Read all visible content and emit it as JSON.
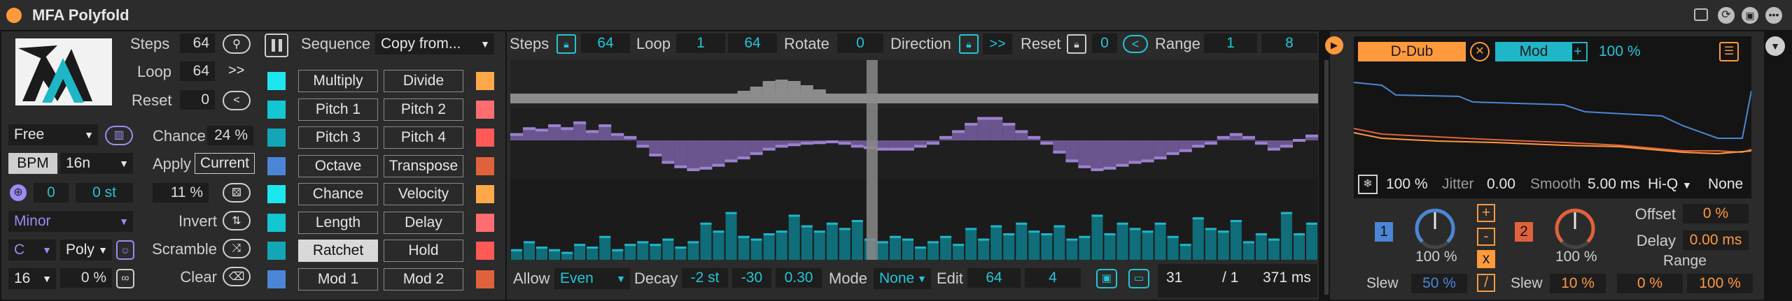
{
  "title": "MFA Polyfold",
  "left": {
    "steps_label": "Steps",
    "steps_value": "64",
    "loop_label": "Loop",
    "loop_value": "64",
    "loop_btn": ">>",
    "reset_label": "Reset",
    "reset_value": "0",
    "reset_btn": "<",
    "mode": "Free",
    "bpm": "BPM",
    "rate": "16n",
    "offset_num": "0",
    "offset_st": "0 st",
    "scale": "Minor",
    "key": "C",
    "voice": "Poly",
    "octaves": "16",
    "percent": "0 %"
  },
  "mid": {
    "chance_label": "Chance",
    "chance_value": "24 %",
    "apply_label": "Apply",
    "apply_value": "Current",
    "prob_value": "11 %",
    "invert_label": "Invert",
    "scramble_label": "Scramble",
    "clear_label": "Clear"
  },
  "sequence": {
    "label": "Sequence",
    "copy": "Copy from...",
    "rows": [
      {
        "a": "Multiply",
        "b": "Divide",
        "ca": "#1ee6ee",
        "cb": "#ffa84a"
      },
      {
        "a": "Pitch 1",
        "b": "Pitch 2",
        "ca": "#12c6d2",
        "cb": "#ff6d72"
      },
      {
        "a": "Pitch 3",
        "b": "Pitch 4",
        "ca": "#12a6b6",
        "cb": "#ff5a58"
      },
      {
        "a": "Octave",
        "b": "Transpose",
        "ca": "#4b86d6",
        "cb": "#e0623c"
      },
      {
        "a": "Chance",
        "b": "Velocity",
        "ca": "#1ee6ee",
        "cb": "#ffa84a"
      },
      {
        "a": "Length",
        "b": "Delay",
        "ca": "#12c6d2",
        "cb": "#ff6d72"
      },
      {
        "a": "Ratchet",
        "b": "Hold",
        "ca": "#12a6b6",
        "cb": "#ff5a58",
        "a_on": true
      },
      {
        "a": "Mod 1",
        "b": "Mod 2",
        "ca": "#4b86d6",
        "cb": "#e0623c"
      }
    ]
  },
  "top": {
    "steps_label": "Steps",
    "steps_value": "64",
    "loop_label": "Loop",
    "loop_start": "1",
    "loop_end": "64",
    "rotate_label": "Rotate",
    "rotate_value": "0",
    "direction_label": "Direction",
    "direction_btn": ">>",
    "reset_label": "Reset",
    "reset_value": "0",
    "reset_btn": "<",
    "range_label": "Range",
    "range_lo": "1",
    "range_hi": "8"
  },
  "bottom": {
    "allow_label": "Allow",
    "allow_value": "Even",
    "decay_label": "Decay",
    "decay_st": "-2 st",
    "decay_a": "-30",
    "decay_b": "0.30",
    "mode_label": "Mode",
    "mode_value": "None",
    "edit_label": "Edit",
    "edit_a": "64",
    "edit_b": "4",
    "pos": "31",
    "div": "/ 1",
    "ms": "371 ms"
  },
  "mod": {
    "ddub": "D-Dub",
    "mod": "Mod",
    "percent": "100 %",
    "rate_pct": "100 %",
    "jitter_label": "Jitter",
    "jitter_value": "0.00",
    "smooth_label": "Smooth",
    "smooth_value": "5.00 ms",
    "quality": "Hi-Q",
    "none": "None",
    "env1_num": "1",
    "env1_pct": "100 %",
    "env2_num": "2",
    "env2_pct": "100 %",
    "slew_label": "Slew",
    "slew1": "50 %",
    "slew2": "10 %",
    "plus": "+",
    "minus": "-",
    "times": "x",
    "slash": "/",
    "offset_label": "Offset",
    "offset_value": "0 %",
    "delay_label": "Delay",
    "delay_value": "0.00 ms",
    "range_label": "Range",
    "range_lo": "0 %",
    "range_hi": "100 %"
  },
  "chart_data": {
    "type": "bar",
    "steps": 64,
    "playhead_step": 28,
    "top_lane": [
      0,
      0,
      0,
      0,
      0,
      0,
      0,
      0,
      0,
      0,
      0,
      0,
      0,
      0,
      0,
      0,
      0,
      0,
      0.2,
      0.5,
      0.9,
      1,
      0.9,
      0.6,
      0.3,
      0,
      0,
      0,
      0,
      0,
      0,
      0,
      0,
      0,
      0,
      0,
      0,
      0,
      0,
      0,
      0,
      0,
      0,
      0,
      0,
      0,
      0,
      0,
      0,
      0,
      0,
      0,
      0,
      0,
      0,
      0,
      0,
      0,
      0,
      0,
      0,
      0,
      0,
      0
    ],
    "pitch_lane": [
      0.2,
      0.4,
      0.35,
      0.5,
      0.4,
      0.6,
      0.3,
      0.5,
      0.2,
      0.1,
      -0.2,
      -0.5,
      -0.75,
      -0.9,
      -1,
      -0.95,
      -0.85,
      -0.7,
      -0.6,
      -0.45,
      -0.3,
      -0.2,
      -0.15,
      -0.1,
      -0.08,
      -0.05,
      -0.1,
      -0.2,
      -0.25,
      -0.3,
      -0.3,
      -0.3,
      -0.2,
      -0.1,
      0.1,
      0.3,
      0.55,
      0.75,
      0.75,
      0.55,
      0.3,
      0.1,
      -0.1,
      -0.4,
      -0.7,
      -0.9,
      -1,
      -0.95,
      -0.85,
      -0.75,
      -0.7,
      -0.6,
      -0.45,
      -0.35,
      -0.2,
      -0.1,
      0.1,
      0.2,
      0.1,
      -0.1,
      -0.3,
      -0.2,
      0,
      0.15
    ],
    "vel_lane": [
      0.2,
      0.35,
      0.25,
      0.2,
      0.15,
      0.3,
      0.25,
      0.45,
      0.2,
      0.3,
      0.35,
      0.3,
      0.4,
      0.25,
      0.35,
      0.7,
      0.55,
      0.9,
      0.45,
      0.4,
      0.5,
      0.55,
      0.85,
      0.65,
      0.55,
      0.7,
      0.6,
      0.75,
      0.4,
      0.35,
      0.45,
      0.4,
      0.25,
      0.35,
      0.45,
      0.3,
      0.6,
      0.4,
      0.65,
      0.5,
      0.7,
      0.55,
      0.5,
      0.65,
      0.4,
      0.45,
      0.85,
      0.5,
      0.7,
      0.6,
      0.55,
      0.7,
      0.45,
      0.3,
      0.8,
      0.6,
      0.55,
      0.75,
      0.35,
      0.5,
      0.4,
      0.9,
      0.5,
      0.7
    ]
  }
}
